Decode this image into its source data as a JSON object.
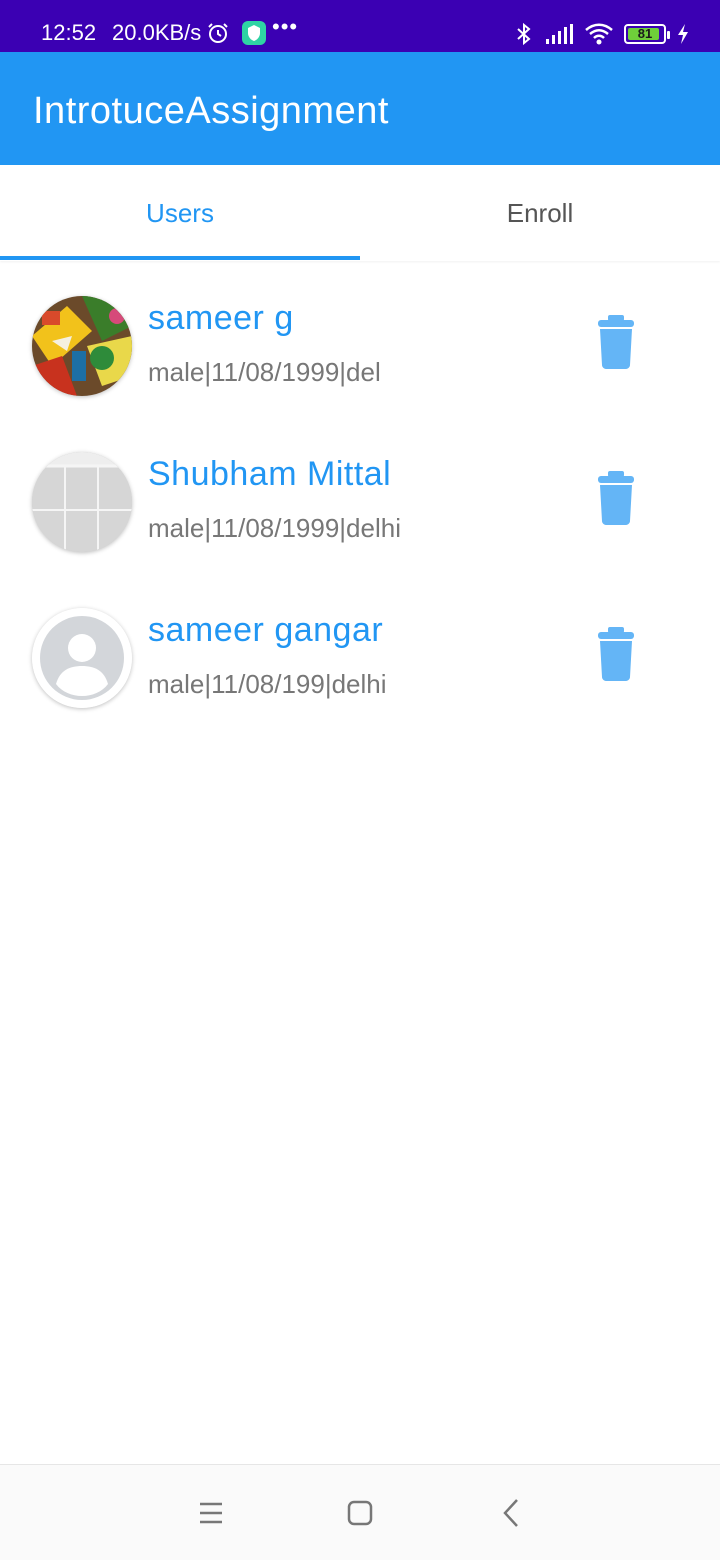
{
  "status_bar": {
    "time": "12:52",
    "network_speed": "20.0KB/s",
    "more": "•••",
    "battery_level": "81",
    "icons": [
      "alarm-icon",
      "security-shield-icon",
      "bluetooth-icon",
      "signal-icon",
      "wifi-icon",
      "battery-icon",
      "charging-icon"
    ]
  },
  "app_bar": {
    "title": "IntrotuceAssignment"
  },
  "tabs": [
    {
      "label": "Users",
      "selected": true
    },
    {
      "label": "Enroll",
      "selected": false
    }
  ],
  "users": [
    {
      "name": "sameer g",
      "details": "male|11/08/1999|del",
      "avatar": "painting-photo"
    },
    {
      "name": "Shubham Mittal",
      "details": "male|11/08/1999|delhi",
      "avatar": "grid-photo"
    },
    {
      "name": "sameer gangar",
      "details": "male|11/08/199|delhi",
      "avatar": "default-person"
    }
  ],
  "colors": {
    "primary": "#2196f3",
    "status_bar": "#3b00b3",
    "delete_icon": "#64b5f6",
    "secondary_text": "#777777"
  },
  "nav_bar": {
    "icons": [
      "menu-icon",
      "home-icon",
      "back-icon"
    ]
  }
}
